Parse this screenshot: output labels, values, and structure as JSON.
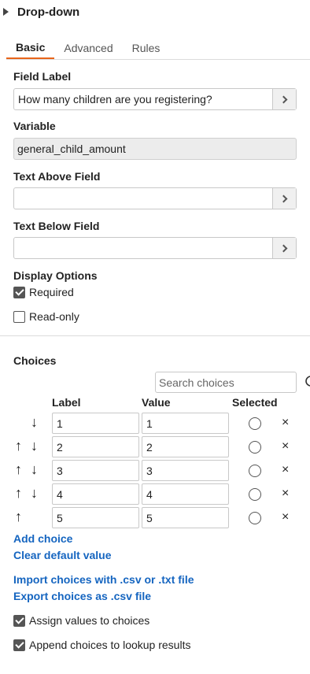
{
  "header": {
    "title": "Drop-down",
    "icon": "caret-right-icon"
  },
  "tabs": [
    {
      "label": "Basic",
      "active": true
    },
    {
      "label": "Advanced",
      "active": false
    },
    {
      "label": "Rules",
      "active": false
    }
  ],
  "fields": {
    "field_label": {
      "label": "Field Label",
      "value": "How many children are you registering?"
    },
    "variable": {
      "label": "Variable",
      "value": "general_child_amount"
    },
    "text_above": {
      "label": "Text Above Field",
      "value": ""
    },
    "text_below": {
      "label": "Text Below Field",
      "value": ""
    }
  },
  "display_options": {
    "title": "Display Options",
    "required": {
      "label": "Required",
      "checked": true
    },
    "readonly": {
      "label": "Read-only",
      "checked": false
    }
  },
  "choices": {
    "title": "Choices",
    "search_placeholder": "Search choices",
    "columns": {
      "label": "Label",
      "value": "Value",
      "selected": "Selected"
    },
    "rows": [
      {
        "label": "1",
        "value": "1",
        "up": false,
        "down": true
      },
      {
        "label": "2",
        "value": "2",
        "up": true,
        "down": true
      },
      {
        "label": "3",
        "value": "3",
        "up": true,
        "down": true
      },
      {
        "label": "4",
        "value": "4",
        "up": true,
        "down": true
      },
      {
        "label": "5",
        "value": "5",
        "up": true,
        "down": false
      }
    ],
    "up_glyph": "↑",
    "down_glyph": "↓",
    "remove_glyph": "×",
    "add_choice": "Add choice",
    "clear_default": "Clear default value",
    "import": "Import choices with .csv or .txt file",
    "export": "Export choices as .csv file"
  },
  "bottom_options": {
    "assign_values": {
      "label": "Assign values to choices",
      "checked": true
    },
    "append_lookup": {
      "label": "Append choices to lookup results",
      "checked": true
    }
  },
  "colors": {
    "accent": "#e8651a",
    "link": "#1565c0"
  }
}
